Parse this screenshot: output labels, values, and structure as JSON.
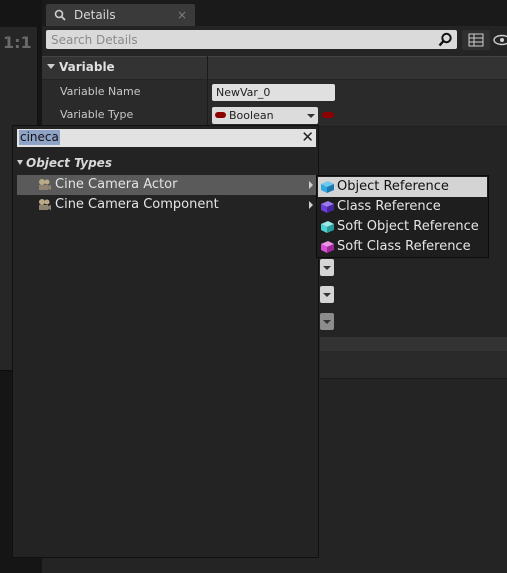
{
  "viewport": {
    "ratio_label": "1:1"
  },
  "details_tab": {
    "title": "Details",
    "close": "×"
  },
  "search": {
    "placeholder": "Search Details"
  },
  "category": {
    "label": "Variable"
  },
  "properties": {
    "variable_name": {
      "label": "Variable Name",
      "value": "NewVar_0"
    },
    "variable_type": {
      "label": "Variable Type",
      "value": "Boolean"
    }
  },
  "type_picker": {
    "search_value": "cineca",
    "clear": "✕",
    "category": "Object Types",
    "items": [
      {
        "label": "Cine Camera Actor",
        "selected": true
      },
      {
        "label": "Cine Camera Component",
        "selected": false
      }
    ],
    "submenu": [
      {
        "label": "Object Reference",
        "icon": "object-reference-icon",
        "color": "#2fa7e0",
        "selected": true
      },
      {
        "label": "Class Reference",
        "icon": "class-reference-icon",
        "color": "#6a3fd6",
        "selected": false
      },
      {
        "label": "Soft Object Reference",
        "icon": "soft-object-reference-icon",
        "color": "#4fd1d1",
        "selected": false
      },
      {
        "label": "Soft Class Reference",
        "icon": "soft-class-reference-icon",
        "color": "#d64fd0",
        "selected": false
      }
    ]
  },
  "colors": {
    "boolean_pin": "#8c0000"
  }
}
